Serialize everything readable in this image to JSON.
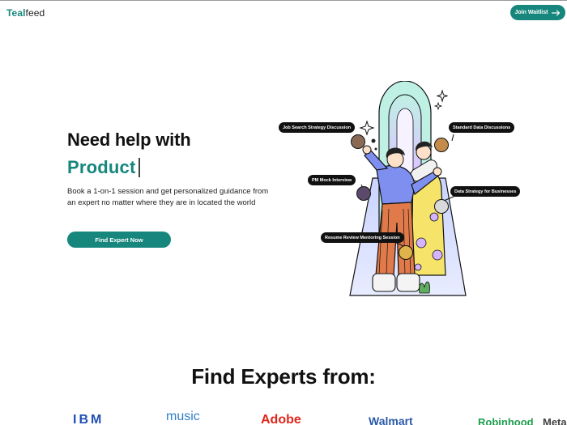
{
  "header": {
    "logo_part1": "Teal",
    "logo_part2": "feed",
    "waitlist_label": "Join Waitlist"
  },
  "hero": {
    "title": "Need help with",
    "rotating_word": "Product",
    "description": "Book a 1-on-1 session and get personalized guidance from an expert no matter where they are in located the world",
    "cta_label": "Find Expert Now"
  },
  "illustration": {
    "chips": [
      "Job Search Strategy Discussion",
      "Standard Data Discussions",
      "PM Mock Interview",
      "Data Strategy for Businesses",
      "Resume Review Mentoring Session"
    ]
  },
  "experts": {
    "title": "Find Experts from:",
    "brands": [
      "IBM",
      "music",
      "Adobe",
      "Walmart",
      "Robinhood",
      "Meta"
    ]
  },
  "colors": {
    "brand_teal": "#17877d",
    "text_dark": "#111111"
  },
  "icons": {
    "waitlist_arrow": "arrow-right-icon"
  }
}
